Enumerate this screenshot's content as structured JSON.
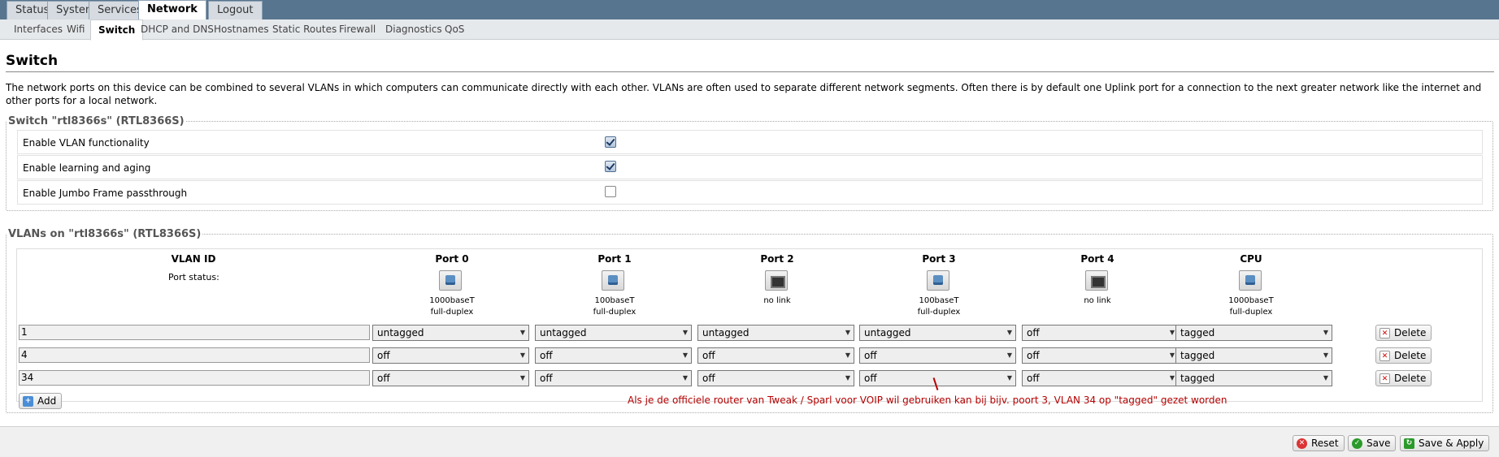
{
  "top_tabs": [
    {
      "label": "Status",
      "active": false
    },
    {
      "label": "System",
      "active": false
    },
    {
      "label": "Services",
      "active": false
    },
    {
      "label": "Network",
      "active": true
    },
    {
      "label": "Logout",
      "active": false
    }
  ],
  "sub_tabs": [
    {
      "label": "Interfaces",
      "active": false
    },
    {
      "label": "Wifi",
      "active": false
    },
    {
      "label": "Switch",
      "active": true
    },
    {
      "label": "DHCP and DNS",
      "active": false
    },
    {
      "label": "Hostnames",
      "active": false
    },
    {
      "label": "Static Routes",
      "active": false
    },
    {
      "label": "Firewall",
      "active": false
    },
    {
      "label": "Diagnostics",
      "active": false
    },
    {
      "label": "QoS",
      "active": false
    }
  ],
  "page_title": "Switch",
  "intro": "The network ports on this device can be combined to several VLANs in which computers can communicate directly with each other. VLANs are often used to separate different network segments. Often there is by default one Uplink port for a connection to the next greater network like the internet and other ports for a local network.",
  "switch_section": {
    "legend": "Switch \"rtl8366s\" (RTL8366S)",
    "rows": [
      {
        "label": "Enable VLAN functionality",
        "checked": true
      },
      {
        "label": "Enable learning and aging",
        "checked": true
      },
      {
        "label": "Enable Jumbo Frame passthrough",
        "checked": false
      }
    ]
  },
  "vlan_section": {
    "legend": "VLANs on \"rtl8366s\" (RTL8366S)",
    "col_vlan_id": "VLAN ID",
    "port_status_label": "Port status:",
    "ports": [
      {
        "name": "Port 0",
        "status": "up",
        "speed": "1000baseT",
        "duplex": "full-duplex"
      },
      {
        "name": "Port 1",
        "status": "up",
        "speed": "100baseT",
        "duplex": "full-duplex"
      },
      {
        "name": "Port 2",
        "status": "down",
        "speed": "no link",
        "duplex": ""
      },
      {
        "name": "Port 3",
        "status": "up",
        "speed": "100baseT",
        "duplex": "full-duplex"
      },
      {
        "name": "Port 4",
        "status": "down",
        "speed": "no link",
        "duplex": ""
      },
      {
        "name": "CPU",
        "status": "up",
        "speed": "1000baseT",
        "duplex": "full-duplex"
      }
    ],
    "vlans": [
      {
        "id": "1",
        "members": [
          "untagged",
          "untagged",
          "untagged",
          "untagged",
          "off",
          "tagged"
        ]
      },
      {
        "id": "4",
        "members": [
          "off",
          "off",
          "off",
          "off",
          "off",
          "tagged"
        ]
      },
      {
        "id": "34",
        "members": [
          "off",
          "off",
          "off",
          "off",
          "off",
          "tagged"
        ]
      }
    ],
    "delete_label": "Delete",
    "add_label": "Add"
  },
  "annotation": "Als je de officiele router van Tweak / Sparl voor VOIP wil gebruiken kan bij bijv. poort 3, VLAN 34 op \"tagged\" gezet worden",
  "footer": {
    "reset_label": "Reset",
    "save_label": "Save",
    "save_apply_label": "Save & Apply"
  },
  "colors": {
    "topbar": "#58758f",
    "annotation": "#b40000"
  }
}
